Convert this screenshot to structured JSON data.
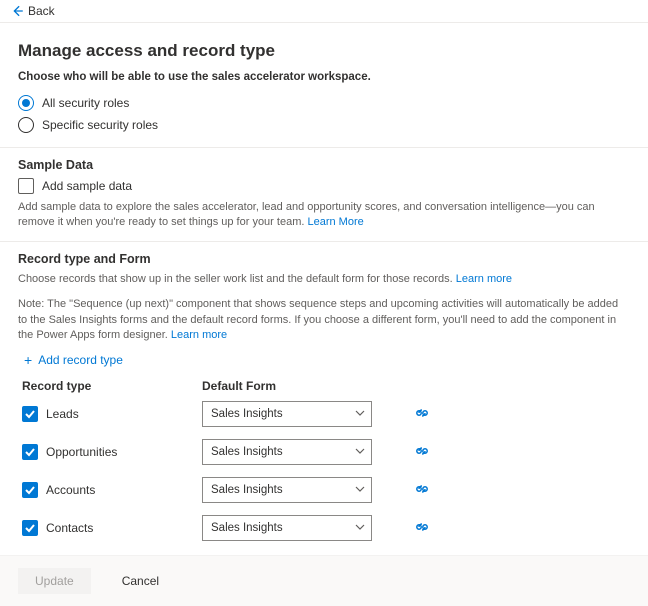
{
  "nav": {
    "back": "Back"
  },
  "page": {
    "title": "Manage access and record type",
    "subhead": "Choose who will be able to use the sales accelerator workspace."
  },
  "access": {
    "options": [
      {
        "label": "All security roles",
        "selected": true
      },
      {
        "label": "Specific security roles",
        "selected": false
      }
    ]
  },
  "sample": {
    "title": "Sample Data",
    "checkbox_label": "Add sample data",
    "checked": false,
    "help": "Add sample data to explore the sales accelerator, lead and opportunity scores, and conversation intelligence—you can remove it when you're ready to set things up for your team.",
    "learn_more": "Learn More"
  },
  "recordType": {
    "title": "Record type and Form",
    "desc": "Choose records that show up in the seller work list and the default form for those records.",
    "learn_more": "Learn more",
    "note": "Note: The \"Sequence (up next)\" component that shows sequence steps and upcoming activities will automatically be added to the Sales Insights forms and the default record forms. If you choose a different form, you'll need to add the component in the Power Apps form designer.",
    "note_learn_more": "Learn more",
    "add_label": "Add record type",
    "columns": {
      "type": "Record type",
      "form": "Default Form"
    },
    "rows": [
      {
        "name": "Leads",
        "form": "Sales Insights",
        "checked": true
      },
      {
        "name": "Opportunities",
        "form": "Sales Insights",
        "checked": true
      },
      {
        "name": "Accounts",
        "form": "Sales Insights",
        "checked": true
      },
      {
        "name": "Contacts",
        "form": "Sales Insights",
        "checked": true
      }
    ]
  },
  "footer": {
    "update": "Update",
    "cancel": "Cancel"
  }
}
